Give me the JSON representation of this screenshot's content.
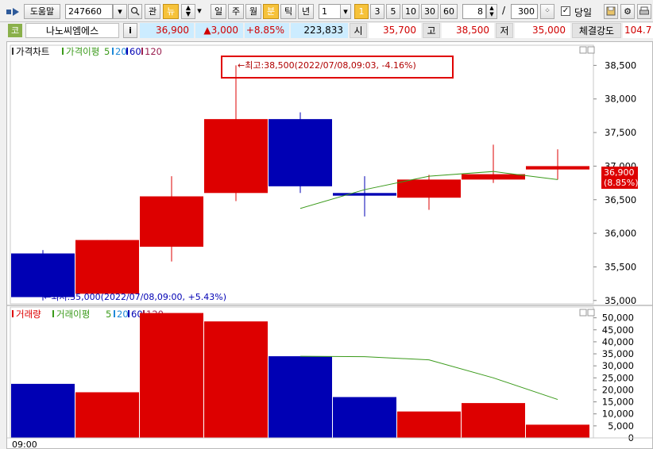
{
  "toolbar": {
    "help_label": "도움말",
    "code_value": "247660",
    "btn_gwan": "관",
    "btn_new": "뉴",
    "period_tabs": [
      "일",
      "주",
      "월",
      "분",
      "틱",
      "년"
    ],
    "selected_period": "분",
    "interval_value": "1",
    "quick_intervals": [
      "3",
      "5",
      "10",
      "30",
      "60"
    ],
    "count_value": "8",
    "slash": "/",
    "max_value": "300",
    "same_day_label": "당일",
    "same_day_checked": true
  },
  "quote": {
    "market_badge": "코",
    "stock_name": "나노씨엠에스",
    "info_label": "i",
    "price": "36,900",
    "change": "▲3,000",
    "change_pct": "+8.85%",
    "volume": "223,833",
    "open_label": "시",
    "open_value": "35,700",
    "high_label": "고",
    "high_value": "38,500",
    "low_label": "저",
    "low_value": "35,000",
    "strength_label": "체결강도",
    "strength_value": "104.7"
  },
  "price_panel": {
    "legend_title": "가격차트",
    "legend_ma_label": "가격이평",
    "legend_periods": [
      "5",
      "20",
      "60",
      "120"
    ],
    "high_annotation": "←최고:38,500(2022/07/08,09:03, -4.16%)",
    "low_annotation": "←최저:35,000(2022/07/08,09:00, +5.43%)",
    "current_label_line1": "36,900",
    "current_label_line2": "(8.85%)",
    "y_ticks": [
      "38,500",
      "38,000",
      "37,500",
      "37,000",
      "36,500",
      "36,000",
      "35,500",
      "35,000"
    ]
  },
  "volume_panel": {
    "legend_title": "거래량",
    "legend_ma_label": "거래이평",
    "legend_periods": [
      "5",
      "20",
      "60",
      "120"
    ],
    "y_ticks": [
      "50,000",
      "45,000",
      "40,000",
      "35,000",
      "30,000",
      "25,000",
      "20,000",
      "15,000",
      "10,000",
      "5,000",
      "0"
    ]
  },
  "x_axis": {
    "first_time": "09:00"
  },
  "colors": {
    "up": "#dd0000",
    "down": "#0000b4",
    "ma5": "#3a9a1a",
    "ma20": "#1f8ad8",
    "ma60": "#0000b4",
    "ma120": "#9a2050"
  },
  "chart_data": {
    "type": "candlestick",
    "series": [
      {
        "name": "가격차트",
        "ohlc": [
          {
            "o": 35700,
            "h": 35750,
            "l": 35000,
            "c": 35050
          },
          {
            "o": 35100,
            "h": 35900,
            "l": 35100,
            "c": 35900
          },
          {
            "o": 35800,
            "h": 36850,
            "l": 35580,
            "c": 36550
          },
          {
            "o": 36600,
            "h": 38500,
            "l": 36480,
            "c": 37700
          },
          {
            "o": 37700,
            "h": 37800,
            "l": 36600,
            "c": 36700
          },
          {
            "o": 36600,
            "h": 36850,
            "l": 36250,
            "c": 36560
          },
          {
            "o": 36530,
            "h": 36870,
            "l": 36350,
            "c": 36800
          },
          {
            "o": 36800,
            "h": 37320,
            "l": 36750,
            "c": 36880
          },
          {
            "o": 36950,
            "h": 37250,
            "l": 36800,
            "c": 37000
          }
        ]
      },
      {
        "name": "가격이평 5",
        "points": [
          null,
          null,
          null,
          null,
          36370,
          36650,
          36850,
          36920,
          36800
        ]
      },
      {
        "name": "거래량",
        "volume": [
          22500,
          19000,
          52000,
          48500,
          34000,
          17000,
          11000,
          14500,
          5500
        ]
      },
      {
        "name": "거래이평 5",
        "points": [
          null,
          null,
          null,
          null,
          34000,
          33800,
          32500,
          25000,
          16000
        ]
      }
    ],
    "price_ylim": [
      34950,
      38800
    ],
    "volume_ylim": [
      0,
      54500
    ],
    "x": [
      "09:00"
    ]
  }
}
